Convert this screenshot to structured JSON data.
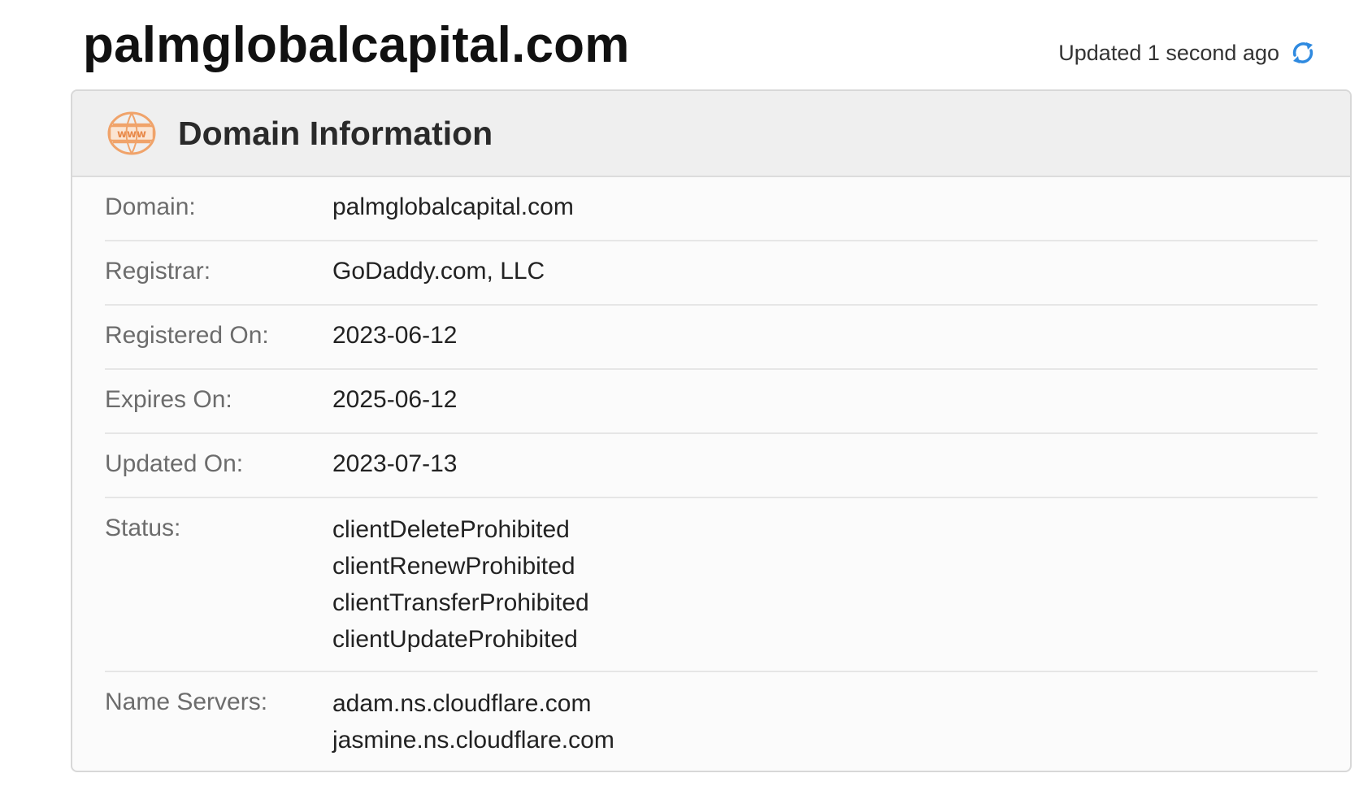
{
  "page": {
    "title": "palmglobalcapital.com",
    "updated_text": "Updated 1 second ago"
  },
  "card": {
    "title": "Domain Information",
    "icon": "www-globe-icon",
    "accent_color": "#f0a36a",
    "refresh_color": "#2f8ae0"
  },
  "rows": {
    "domain": {
      "label": "Domain:",
      "value": "palmglobalcapital.com"
    },
    "registrar": {
      "label": "Registrar:",
      "value": "GoDaddy.com, LLC"
    },
    "registered_on": {
      "label": "Registered On:",
      "value": "2023-06-12"
    },
    "expires_on": {
      "label": "Expires On:",
      "value": "2025-06-12"
    },
    "updated_on": {
      "label": "Updated On:",
      "value": "2023-07-13"
    },
    "status": {
      "label": "Status:",
      "values": [
        "clientDeleteProhibited",
        "clientRenewProhibited",
        "clientTransferProhibited",
        "clientUpdateProhibited"
      ]
    },
    "name_servers": {
      "label": "Name Servers:",
      "values": [
        "adam.ns.cloudflare.com",
        "jasmine.ns.cloudflare.com"
      ]
    }
  }
}
